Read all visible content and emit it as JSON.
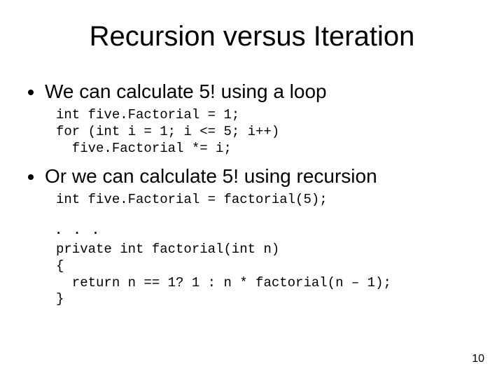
{
  "title": "Recursion versus Iteration",
  "bullet1": "We can calculate 5! using a loop",
  "code1": "int five.Factorial = 1;\nfor (int i = 1; i <= 5; i++)\n  five.Factorial *= i;",
  "bullet2": "Or we can calculate 5! using recursion",
  "code2a": "int five.Factorial = factorial(5);",
  "ellipsis": ". . .",
  "code2b": "private int factorial(int n)\n{\n  return n == 1? 1 : n * factorial(n – 1);\n}",
  "page": "10"
}
